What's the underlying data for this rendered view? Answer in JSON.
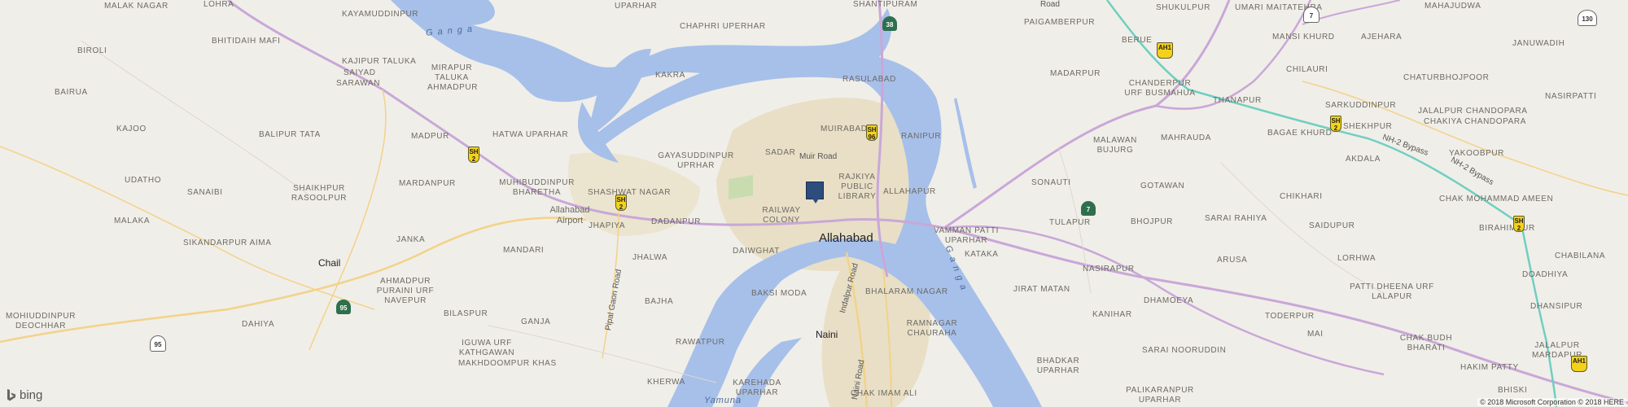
{
  "map": {
    "places": [
      {
        "id": "malak-nagar",
        "text": "MALAK NAGAR"
      },
      {
        "id": "kayamuddinpur",
        "text": "KAYAMUDDINPUR"
      },
      {
        "id": "uparhar",
        "text": "UPARHAR"
      },
      {
        "id": "chaphri-uperhar",
        "text": "CHAPHRI UPERHAR"
      },
      {
        "id": "shantipuram",
        "text": "SHANTIPURAM"
      },
      {
        "id": "lohra",
        "text": "LOHRA"
      },
      {
        "id": "biroli",
        "text": "BIROLI"
      },
      {
        "id": "bhitidaih-mafi",
        "text": "BHITIDAIH MAFI"
      },
      {
        "id": "kajipur-taluka",
        "text": "KAJIPUR TALUKA"
      },
      {
        "id": "saiyad",
        "text": "SAIYAD"
      },
      {
        "id": "sarawan",
        "text": "SARAWAN"
      },
      {
        "id": "mirapur-taluka-ahmadpur",
        "text": "MIRAPUR TALUKA AHMADPUR"
      },
      {
        "id": "kakra",
        "text": "KAKRA"
      },
      {
        "id": "bairua",
        "text": "BAIRUA"
      },
      {
        "id": "rasulabad",
        "text": "RASULABAD"
      },
      {
        "id": "muirabad",
        "text": "MUIRABAD"
      },
      {
        "id": "ranipur",
        "text": "RANIPUR"
      },
      {
        "id": "kajoo",
        "text": "KAJOO"
      },
      {
        "id": "balipur-tata",
        "text": "BALIPUR TATA"
      },
      {
        "id": "madpur",
        "text": "MADPUR"
      },
      {
        "id": "hatwa-uparhar",
        "text": "HATWA UPARHAR"
      },
      {
        "id": "gayasuddinpur-uprhar",
        "text": "GAYASUDDINPUR UPRHAR"
      },
      {
        "id": "sadar",
        "text": "SADAR"
      },
      {
        "id": "udatho",
        "text": "UDATHO"
      },
      {
        "id": "muhibuddinpur-bharetha",
        "text": "MUHIBUDDINPUR BHARETHA"
      },
      {
        "id": "mardanpur",
        "text": "MARDANPUR"
      },
      {
        "id": "shaikhpur-rasoolpur",
        "text": "SHAIKHPUR RASOOLPUR"
      },
      {
        "id": "sanaibi",
        "text": "SANAIBI"
      },
      {
        "id": "shashwat-nagar",
        "text": "SHASHWAT NAGAR"
      },
      {
        "id": "rajkiya-public-library",
        "text": "RAJKIYA PUBLIC LIBRARY"
      },
      {
        "id": "allahapur",
        "text": "ALLAHAPUR"
      },
      {
        "id": "malaka",
        "text": "MALAKA"
      },
      {
        "id": "jhapiya",
        "text": "JHAPIYA"
      },
      {
        "id": "dadanpur",
        "text": "DADANPUR"
      },
      {
        "id": "railway-colony",
        "text": "RAILWAY COLONY"
      },
      {
        "id": "vamman-patti-uparhar",
        "text": "VAMMAN PATTI UPARHAR"
      },
      {
        "id": "sikandarpur-aima",
        "text": "SIKANDARPUR AIMA"
      },
      {
        "id": "janka",
        "text": "JANKA"
      },
      {
        "id": "mandari",
        "text": "MANDARI"
      },
      {
        "id": "jhalwa",
        "text": "JHALWA"
      },
      {
        "id": "daiwghat",
        "text": "DAIWGHAT"
      },
      {
        "id": "ahmadpur-purairi",
        "text": "AHMADPUR PURAINI URF NAVEPUR"
      },
      {
        "id": "mohiuddinpur-deochhar",
        "text": "MOHIUDDINPUR DEOCHHAR"
      },
      {
        "id": "bajha",
        "text": "BAJHA"
      },
      {
        "id": "baksi-moda",
        "text": "BAKSI MODA"
      },
      {
        "id": "bhalaram-nagar",
        "text": "BHALARAM NAGAR"
      },
      {
        "id": "bilaspur",
        "text": "BILASPUR"
      },
      {
        "id": "ganja",
        "text": "GANJA"
      },
      {
        "id": "dahiya",
        "text": "DAHIYA"
      },
      {
        "id": "rawatpur",
        "text": "RAWATPUR"
      },
      {
        "id": "ramnagar-chauraha",
        "text": "RAMNAGAR CHAURAHA"
      },
      {
        "id": "iguwa-urf-kathgawan",
        "text": "IGUWA URF KATHGAWAN"
      },
      {
        "id": "makhdoompur-khas",
        "text": "MAKHDOOMPUR KHAS"
      },
      {
        "id": "kherwa",
        "text": "KHERWA"
      },
      {
        "id": "karehada-uparhar",
        "text": "KAREHADA UPARHAR"
      },
      {
        "id": "chak-imam-ali",
        "text": "CHAK IMAM ALI"
      },
      {
        "id": "paigamberpur",
        "text": "PAIGAMBERPUR"
      },
      {
        "id": "berue",
        "text": "BERUE"
      },
      {
        "id": "shukulpur",
        "text": "SHUKULPUR"
      },
      {
        "id": "umari-maitatehra",
        "text": "UMARI MAITATEHRA"
      },
      {
        "id": "mahajudwa",
        "text": "MAHAJUDWA"
      },
      {
        "id": "mansi-khurd",
        "text": "MANSI KHURD"
      },
      {
        "id": "ajehara",
        "text": "AJEHARA"
      },
      {
        "id": "januwadih",
        "text": "JANUWADIH"
      },
      {
        "id": "madarpur",
        "text": "MADARPUR"
      },
      {
        "id": "chanderpur-urf-busmahua",
        "text": "CHANDERPUR URF BUSMAHUA"
      },
      {
        "id": "chilauri",
        "text": "CHILAURI"
      },
      {
        "id": "chaturbhojpoor",
        "text": "CHATURBHOJPOOR"
      },
      {
        "id": "nasirpatti",
        "text": "NASIRPATTI"
      },
      {
        "id": "thanapur",
        "text": "THANAPUR"
      },
      {
        "id": "sarkuddinpur",
        "text": "SARKUDDINPUR"
      },
      {
        "id": "jalalpur-chandopara",
        "text": "JALALPUR CHANDOPARA"
      },
      {
        "id": "chakiya-chandopara",
        "text": "CHAKIYA CHANDOPARA"
      },
      {
        "id": "shekhpur",
        "text": "SHEKHPUR"
      },
      {
        "id": "bagae-khurd",
        "text": "BAGAE KHURD"
      },
      {
        "id": "malawan-bujurg",
        "text": "MALAWAN BUJURG"
      },
      {
        "id": "mahrauda",
        "text": "MAHRAUDA"
      },
      {
        "id": "akdala",
        "text": "AKDALA"
      },
      {
        "id": "yakoobpur",
        "text": "YAKOOBPUR"
      },
      {
        "id": "sonauti",
        "text": "SONAUTI"
      },
      {
        "id": "gotawan",
        "text": "GOTAWAN"
      },
      {
        "id": "chikhari",
        "text": "CHIKHARI"
      },
      {
        "id": "chak-mohammad-ameen",
        "text": "CHAK MOHAMMAD AMEEN"
      },
      {
        "id": "tulapur",
        "text": "TULAPUR"
      },
      {
        "id": "bhojpur",
        "text": "BHOJPUR"
      },
      {
        "id": "sarai-rahiya",
        "text": "SARAI RAHIYA"
      },
      {
        "id": "saidupur",
        "text": "SAIDUPUR"
      },
      {
        "id": "birahimpur",
        "text": "BIRAHIMPUR"
      },
      {
        "id": "kataka",
        "text": "KATAKA"
      },
      {
        "id": "lorhwa",
        "text": "LORHWA"
      },
      {
        "id": "chabilana",
        "text": "CHABILANA"
      },
      {
        "id": "arusa",
        "text": "ARUSA"
      },
      {
        "id": "jirat-matan",
        "text": "JIRAT MATAN"
      },
      {
        "id": "nasirapur",
        "text": "NASIRAPUR"
      },
      {
        "id": "doadhiya",
        "text": "DOADHIYA"
      },
      {
        "id": "patti-dheena",
        "text": "PATTI DHEENA URF LALAPUR"
      },
      {
        "id": "dhansipur",
        "text": "DHANSIPUR"
      },
      {
        "id": "dhamoeya",
        "text": "DHAMOEYA"
      },
      {
        "id": "kanihar",
        "text": "KANIHAR"
      },
      {
        "id": "toderpur",
        "text": "TODERPUR"
      },
      {
        "id": "mai",
        "text": "MAI"
      },
      {
        "id": "chak-budh-bharati",
        "text": "CHAK BUDH BHARATI"
      },
      {
        "id": "sarai-nooruddin",
        "text": "SARAI NOORUDDIN"
      },
      {
        "id": "jalalpur-mardapur",
        "text": "JALALPUR MARDAPUR"
      },
      {
        "id": "bhadkar-uparhar",
        "text": "BHADKAR UPARHAR"
      },
      {
        "id": "hakim-patty",
        "text": "HAKIM PATTY"
      },
      {
        "id": "palikaranpur-uparhar",
        "text": "PALIKARANPUR UPARHAR"
      },
      {
        "id": "bhiski",
        "text": "BHISKI"
      },
      {
        "id": "allahabad-airport",
        "text": "Allahabad Airport"
      }
    ],
    "towns": {
      "allahabad": "Allahabad",
      "chail": "Chail",
      "naini": "Naini"
    },
    "roads": {
      "muir_road": "Muir Road",
      "pipal_gaon_road": "Pipal Gaon Road",
      "indalpur_road": "Indalpur Road",
      "naini_road": "Naini Road",
      "nh2_bypass": "NH-2 Bypass",
      "nh2_bypass_2": "NH-2 Bypass",
      "road_top": "Road"
    },
    "rivers": {
      "ganga_nw": "Ganga",
      "ganga_se": "Ganga",
      "yamuna": "Yamuna"
    },
    "shields": [
      {
        "id": "sh2-a",
        "label": "SH\n2",
        "type": "state"
      },
      {
        "id": "sh2-b",
        "label": "SH\n2",
        "type": "state"
      },
      {
        "id": "sh96",
        "label": "SH\n96",
        "type": "state"
      },
      {
        "id": "sh2-c",
        "label": "SH\n2",
        "type": "state"
      },
      {
        "id": "sh2-d",
        "label": "SH\n2",
        "type": "state"
      },
      {
        "id": "ah1-a",
        "label": "AH1",
        "type": "state"
      },
      {
        "id": "ah1-b",
        "label": "AH1",
        "type": "state"
      },
      {
        "id": "nh38",
        "label": "38",
        "type": "nh"
      },
      {
        "id": "nh7-a",
        "label": "7",
        "type": "nh"
      },
      {
        "id": "nh7-b",
        "label": "7",
        "type": "nh"
      },
      {
        "id": "nh95-a",
        "label": "95",
        "type": "nh"
      },
      {
        "id": "nh95-b",
        "label": "95",
        "type": "nh"
      },
      {
        "id": "nh130",
        "label": "130",
        "type": "nh"
      }
    ],
    "footer": {
      "brand": "bing",
      "copyright": "© 2018 Microsoft Corporation © 2018 HERE"
    },
    "colors": {
      "land": "#f0eee8",
      "water": "#a6c0ea",
      "urban": "#e8dfc6",
      "major_road": "#c9a7d8",
      "secondary_road": "#f3d28a",
      "green": "#c9dcb0",
      "nh_bypass": "#6fcfc2",
      "pin": "#2d4d7c"
    }
  }
}
